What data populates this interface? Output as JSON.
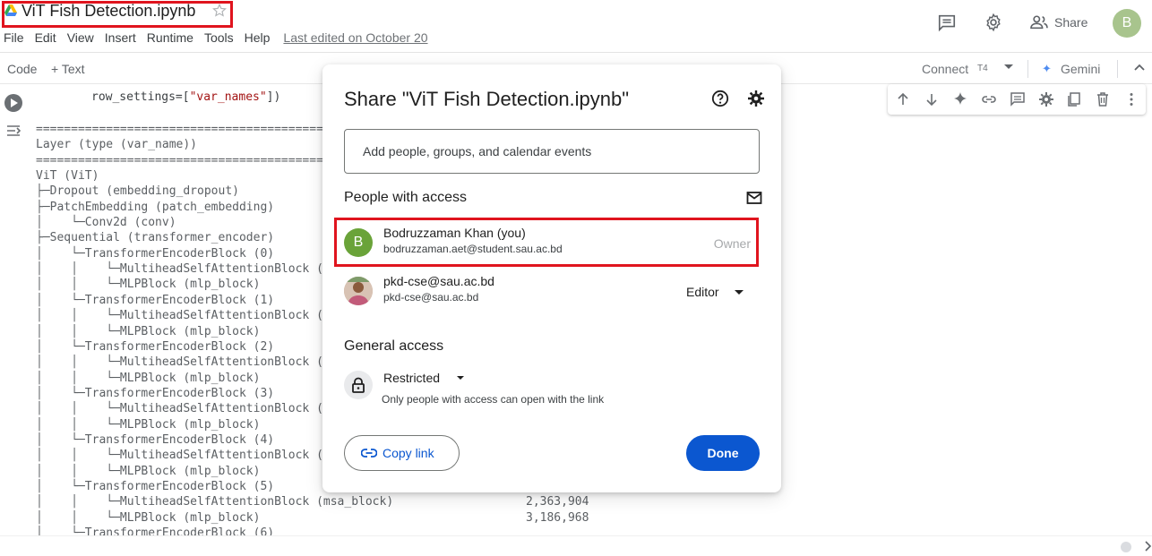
{
  "header": {
    "notebook_title": "ViT Fish Detection.ipynb",
    "menu": [
      "File",
      "Edit",
      "View",
      "Insert",
      "Runtime",
      "Tools",
      "Help"
    ],
    "last_edited": "Last edited on October 20",
    "share_label": "Share",
    "avatar_letter": "B"
  },
  "toolbar": {
    "code_label": "Code",
    "text_label": "+ Text",
    "connect_label": "Connect",
    "runtime_type": "T4",
    "gemini_label": "Gemini"
  },
  "code": {
    "line_prefix": "row_settings=[",
    "line_string": "\"var_names\"",
    "line_suffix": "])"
  },
  "output": {
    "separator": "============================================================================================",
    "header": "Layer (type (var_name))",
    "lines": [
      "ViT (ViT)",
      "├─Dropout (embedding_dropout)",
      "├─PatchEmbedding (patch_embedding)",
      "│    └─Conv2d (conv)",
      "├─Sequential (transformer_encoder)",
      "│    └─TransformerEncoderBlock (0)",
      "│    │    └─MultiheadSelfAttentionBlock (msa_block)",
      "│    │    └─MLPBlock (mlp_block)",
      "│    └─TransformerEncoderBlock (1)",
      "│    │    └─MultiheadSelfAttentionBlock (msa_block)",
      "│    │    └─MLPBlock (mlp_block)",
      "│    └─TransformerEncoderBlock (2)",
      "│    │    └─MultiheadSelfAttentionBlock (msa_block)",
      "│    │    └─MLPBlock (mlp_block)",
      "│    └─TransformerEncoderBlock (3)",
      "│    │    └─MultiheadSelfAttentionBlock (msa_block)",
      "│    │    └─MLPBlock (mlp_block)",
      "│    └─TransformerEncoderBlock (4)",
      "│    │    └─MultiheadSelfAttentionBlock (msa_block)",
      "│    │    └─MLPBlock (mlp_block)",
      "│    └─TransformerEncoderBlock (5)",
      "│    │    └─MultiheadSelfAttentionBlock (msa_block)",
      "│    │    └─MLPBlock (mlp_block)",
      "│    └─TransformerEncoderBlock (6)"
    ],
    "param_msa_5": "2,363,904",
    "param_mlp_5": "3,186,968"
  },
  "dialog": {
    "title": "Share \"ViT Fish Detection.ipynb\"",
    "input_placeholder": "Add people, groups, and calendar events",
    "people_with_access": "People with access",
    "people": [
      {
        "avatar_letter": "B",
        "name": "Bodruzzaman Khan (you)",
        "email": "bodruzzaman.aet@student.sau.ac.bd",
        "role": "Owner"
      },
      {
        "name": "pkd-cse@sau.ac.bd",
        "email": "pkd-cse@sau.ac.bd",
        "role": "Editor"
      }
    ],
    "general_access": "General access",
    "access_level": "Restricted",
    "access_description": "Only people with access can open with the link",
    "copy_link": "Copy link",
    "done": "Done"
  },
  "colors": {
    "accent": "#0b57d0",
    "highlight": "#e0141e",
    "owner_avatar": "#6aa339",
    "user_avatar": "#a8c48d"
  }
}
